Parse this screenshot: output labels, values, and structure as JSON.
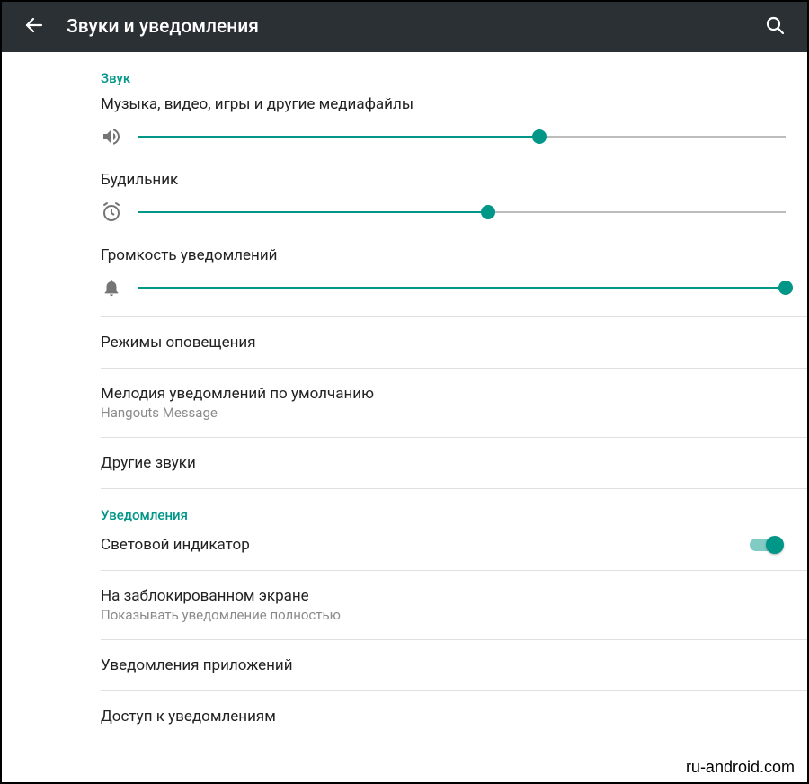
{
  "accent": "#009688",
  "appbar": {
    "title": "Звуки и уведомления"
  },
  "sections": {
    "sound": {
      "header": "Звук",
      "media": {
        "label": "Музыка, видео, игры и другие медиафайлы",
        "value": 62
      },
      "alarm": {
        "label": "Будильник",
        "value": 54
      },
      "notif": {
        "label": "Громкость уведомлений",
        "value": 100
      }
    },
    "rows": {
      "modes": {
        "title": "Режимы оповещения"
      },
      "ringtone": {
        "title": "Мелодия уведомлений по умолчанию",
        "sub": "Hangouts Message"
      },
      "other": {
        "title": "Другие звуки"
      }
    },
    "notifications": {
      "header": "Уведомления",
      "pulse": {
        "title": "Световой индикатор",
        "on": true
      },
      "lockscreen": {
        "title": "На заблокированном экране",
        "sub": "Показывать уведомление полностью"
      },
      "appnotif": {
        "title": "Уведомления приложений"
      },
      "access": {
        "title": "Доступ к уведомлениям"
      }
    }
  },
  "watermark": "ru-android.com"
}
